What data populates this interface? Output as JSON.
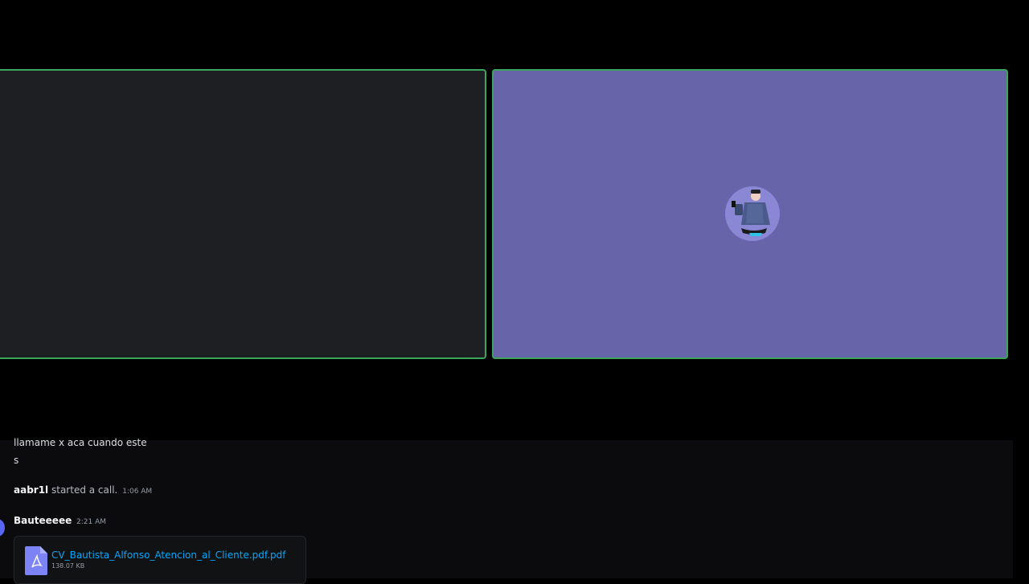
{
  "call": {
    "tiles": [
      {
        "id": "tile-left",
        "state": "video-off"
      },
      {
        "id": "tile-right",
        "state": "avatar"
      }
    ]
  },
  "chat": {
    "partial_message_line1": "llamame x aca cuando este",
    "partial_message_line2": "s",
    "system_message": {
      "user": "aabr1l",
      "text": "started a call.",
      "time": "1:06 AM"
    },
    "message": {
      "author": "Bauteeeee",
      "time": "2:21 AM",
      "attachment": {
        "name": "CV_Bautista_Alfonso_Atencion_al_Cliente.pdf.pdf",
        "size": "138.07 KB",
        "icon": "pdf-file-icon"
      }
    }
  },
  "colors": {
    "speaking_border": "#3ba55c",
    "tile_dark": "#1e1f22",
    "tile_accent": "#6764aa",
    "link": "#00a8fc"
  }
}
